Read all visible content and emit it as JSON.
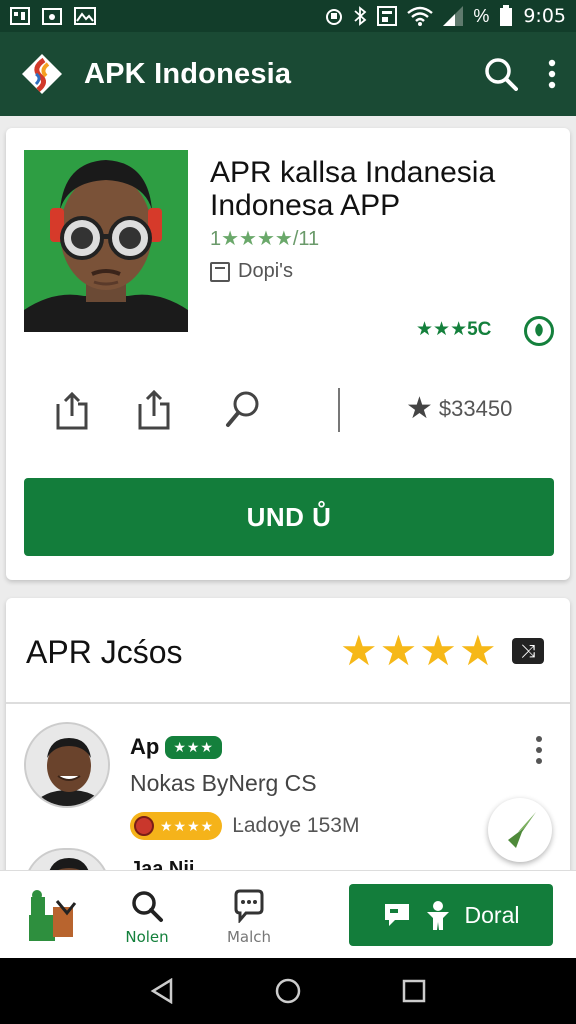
{
  "status_bar": {
    "time": "9:05",
    "icons": [
      "image-icon",
      "camera-icon",
      "photo-icon",
      "alarm-icon",
      "bluetooth-icon",
      "nfc-icon",
      "wifi-icon",
      "signal-icon",
      "battery-icon"
    ],
    "percent_glyph": "%"
  },
  "app_bar": {
    "title": "APK Indonesia",
    "background": "#1a4a34",
    "icons": [
      "app-logo-icon",
      "search-icon",
      "more-vert-icon"
    ]
  },
  "app_card": {
    "name": "APR kallsa Indanesia Indonesa APP",
    "rating_prefix": "1",
    "rating_stars": "★★★★",
    "rating_suffix": "/11",
    "developer": "Dopi's",
    "green_rating": "★★★5C",
    "price": "$33450",
    "install_label": "UND Ů",
    "accent": "#137d3b"
  },
  "reviews": {
    "title": "APR Jcśos",
    "stars": "★★★★",
    "star_color": "#f6b818",
    "shuffle_glyph": "⤨",
    "items": [
      {
        "name": "Ap",
        "badge": "★★★",
        "subtitle": "Nokas ByNerg CS",
        "meta_badge": "★★★★",
        "meta_text": "Ŀadoye 153M"
      },
      {
        "name": "Jaa Nii"
      }
    ]
  },
  "bottom_nav": {
    "search_label": "Nolen",
    "match_label": "Malch",
    "donate_label": "Doral"
  }
}
